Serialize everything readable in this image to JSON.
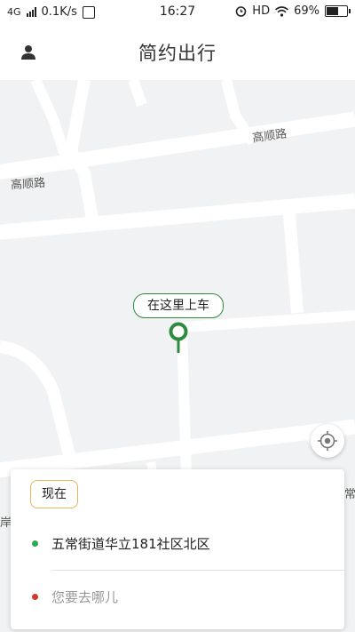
{
  "status_bar": {
    "network_type": "4G",
    "speed": "0.1K/s",
    "time": "16:27",
    "hd": "HD",
    "battery": "69%",
    "battery_level": 0.69
  },
  "header": {
    "title": "简约出行"
  },
  "map": {
    "road_labels": [
      "高顺路",
      "高顺路"
    ],
    "edge_labels": [
      "岸",
      "常"
    ]
  },
  "pickup": {
    "label": "在这里上车"
  },
  "booking": {
    "time_button": "现在",
    "origin": "五常街道华立181社区北区",
    "destination_placeholder": "您要去哪儿"
  },
  "colors": {
    "accent_green": "#2e8b3e",
    "origin_dot": "#2eaa55",
    "destination_dot": "#d23a2e",
    "time_button_border": "#e6b35c"
  }
}
